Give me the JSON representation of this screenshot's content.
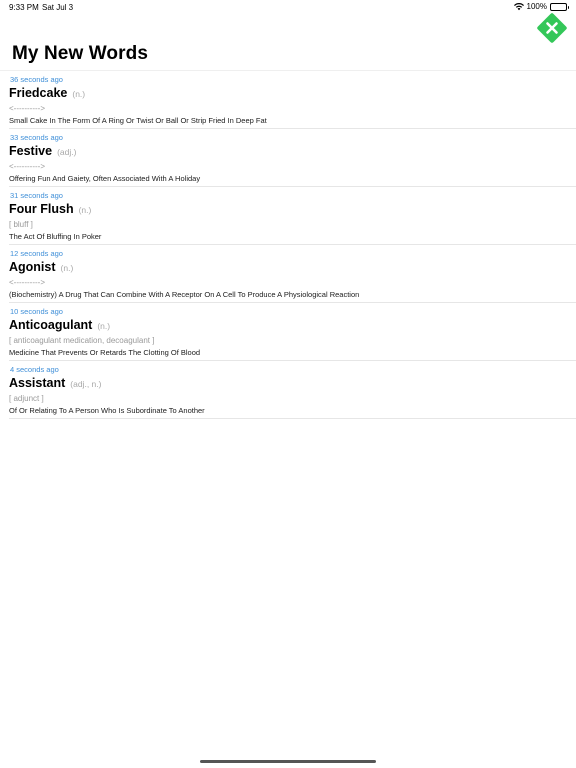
{
  "status_bar": {
    "time": "9:33 PM",
    "date": "Sat Jul 3",
    "battery": "100%",
    "wifi_icon": "wifi-icon",
    "battery_icon": "battery-full-icon"
  },
  "header": {
    "title": "My New Words",
    "close_icon": "close-icon",
    "close_color": "#34c759"
  },
  "colors": {
    "timestamp": "#3f8fd8",
    "part_of_speech": "#a8a8a8"
  },
  "entries": [
    {
      "time": "36 seconds ago",
      "word": "Friedcake",
      "pos": "(n.)",
      "synonyms": "<---------->",
      "definition": "Small Cake In The Form Of A Ring Or Twist Or Ball Or Strip Fried In Deep Fat"
    },
    {
      "time": "33 seconds ago",
      "word": "Festive",
      "pos": "(adj.)",
      "synonyms": "<---------->",
      "definition": "Offering Fun And Gaiety, Often Associated With A Holiday"
    },
    {
      "time": "31 seconds ago",
      "word": "Four Flush",
      "pos": "(n.)",
      "synonyms": "[ bluff ]",
      "definition": "The Act Of Bluffing In Poker"
    },
    {
      "time": "12 seconds ago",
      "word": "Agonist",
      "pos": "(n.)",
      "synonyms": "<---------->",
      "definition": "(Biochemistry) A Drug That Can Combine With A Receptor On A Cell To Produce A Physiological Reaction"
    },
    {
      "time": "10 seconds ago",
      "word": "Anticoagulant",
      "pos": "(n.)",
      "synonyms": "[ anticoagulant medication, decoagulant ]",
      "definition": "Medicine That Prevents Or Retards The Clotting Of Blood"
    },
    {
      "time": "4 seconds ago",
      "word": "Assistant",
      "pos": "(adj., n.)",
      "synonyms": "[ adjunct ]",
      "definition": "Of Or Relating To A Person Who Is Subordinate To Another"
    }
  ]
}
